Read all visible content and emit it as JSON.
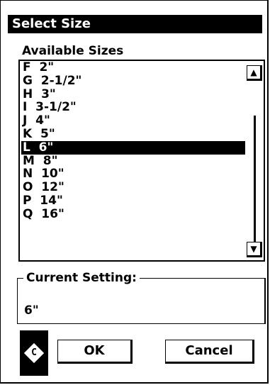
{
  "dialog": {
    "title": "Select Size",
    "list_label": "Available Sizes",
    "items": [
      {
        "text": "F  2\""
      },
      {
        "text": "G  2-1/2\""
      },
      {
        "text": "H  3\""
      },
      {
        "text": "I  3-1/2\""
      },
      {
        "text": "J  4\""
      },
      {
        "text": "K  5\""
      },
      {
        "text": "L  6\""
      },
      {
        "text": "M  8\""
      },
      {
        "text": "N  10\""
      },
      {
        "text": "O  12\""
      },
      {
        "text": "P  14\""
      },
      {
        "text": "Q  16\""
      }
    ],
    "selected_index": 6,
    "current_setting_label": "Current Setting:",
    "current_setting_value": "6\"",
    "icon_letter": "C",
    "ok_label": "OK",
    "cancel_label": "Cancel",
    "scroll_up_glyph": "▲",
    "scroll_down_glyph": "▼"
  }
}
